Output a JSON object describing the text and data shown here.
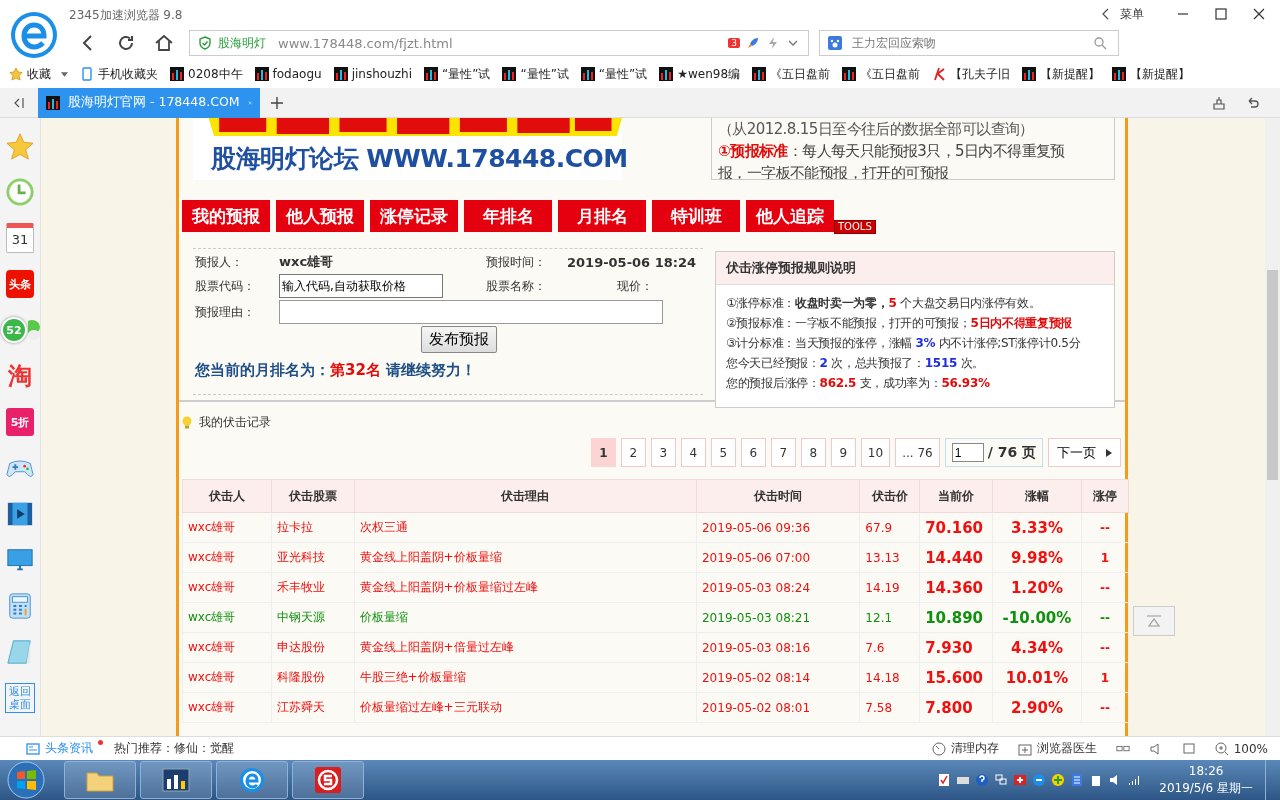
{
  "browser": {
    "title": "2345加速浏览器 9.8",
    "menu": "菜单",
    "site_badge": "股海明灯",
    "url_host": "www.178448.com",
    "url_path": "/fjzt.html",
    "badge_count": "3",
    "search_placeholder": "王力宏回应索吻"
  },
  "bookmarks": [
    {
      "label": "收藏",
      "kind": "folder"
    },
    {
      "label": "手机收藏夹",
      "kind": "mobile"
    },
    {
      "label": "0208中午",
      "kind": "site"
    },
    {
      "label": "fodaogu",
      "kind": "site"
    },
    {
      "label": "jinshouzhi",
      "kind": "site"
    },
    {
      "label": "“量性”试",
      "kind": "site"
    },
    {
      "label": "“量性”试",
      "kind": "site"
    },
    {
      "label": "“量性”试",
      "kind": "site"
    },
    {
      "label": "★wen98编",
      "kind": "site"
    },
    {
      "label": "《五日盘前",
      "kind": "site"
    },
    {
      "label": "《五日盘前",
      "kind": "site"
    },
    {
      "label": "【孔夫子旧",
      "kind": "k"
    },
    {
      "label": "【新提醒】",
      "kind": "site"
    },
    {
      "label": "【新提醒】",
      "kind": "site"
    }
  ],
  "tabs": [
    {
      "label": "股海明灯官网 - 178448.COM",
      "selected": true
    }
  ],
  "sidebar": [
    {
      "kind": "star"
    },
    {
      "kind": "clock"
    },
    {
      "kind": "calendar",
      "text": "31"
    },
    {
      "kind": "red",
      "text": "头条"
    },
    {
      "kind": "chat",
      "badge": "52"
    },
    {
      "kind": "tao",
      "text": "淘"
    },
    {
      "kind": "sale",
      "text": "5折"
    },
    {
      "kind": "gamepad"
    },
    {
      "kind": "video"
    },
    {
      "kind": "monitor"
    },
    {
      "kind": "calculator"
    },
    {
      "kind": "notepad"
    },
    {
      "kind": "desk",
      "text": "返回桌面"
    }
  ],
  "page": {
    "banner_text": "股海明灯论坛 WWW.178448.COM",
    "notice": [
      "（从2012.8.15日至今往后的数据全部可以查询）",
      "**①预报标准**：每人每天只能预报3只，5日内不得重复预",
      "报，一字板不能预报，打开的可预报"
    ],
    "nav": [
      {
        "label": "我的预报",
        "kind": "main"
      },
      {
        "label": "他人预报",
        "kind": "main"
      },
      {
        "label": "涨停记录",
        "kind": "main"
      },
      {
        "label": "年排名",
        "kind": "main"
      },
      {
        "label": "月排名",
        "kind": "main"
      },
      {
        "label": "特训班",
        "kind": "main"
      },
      {
        "label": "他人追踪",
        "kind": "main"
      },
      {
        "label": "TOOLS",
        "kind": "tools"
      }
    ],
    "form": {
      "reporter_label": "预报人：",
      "reporter": "wxc雄哥",
      "time_label": "预报时间：",
      "time": "2019-05-06 18:24",
      "code_label": "股票代码：",
      "code_value": "输入代码,自动获取价格",
      "name_label": "股票名称：",
      "price_label": "现价：",
      "reason_label": "预报理由：",
      "submit": "发布预报"
    },
    "rank": {
      "prefix": "您当前的月排名为：",
      "rank": "第32名",
      "suffix": " 请继续努力！"
    },
    "rules": {
      "title": "伏击涨停预报规则说明",
      "lines": [
        [
          {
            "text": "①涨停标准：",
            "kind": "text"
          },
          {
            "text": "收盘时卖一为零，",
            "kind": "rule"
          },
          {
            "text": "5",
            "kind": "alert"
          },
          {
            "text": " 个大盘交易日内涨停有效。",
            "kind": "text"
          }
        ],
        [
          {
            "text": "②预报标准：一字板不能预报，打开的可预报；",
            "kind": "text"
          },
          {
            "text": "5日内不得重复预报",
            "kind": "alert"
          }
        ],
        [
          {
            "text": "③计分标准：当天预报的涨停，涨幅 ",
            "kind": "text"
          },
          {
            "text": "3%",
            "kind": "number"
          },
          {
            "text": " 内不计涨停;ST涨停计0.5分",
            "kind": "text"
          }
        ],
        [
          {
            "text": "您今天已经预报：",
            "kind": "text"
          },
          {
            "text": "2",
            "kind": "number"
          },
          {
            "text": " 次，总共预报了：",
            "kind": "text"
          },
          {
            "text": "1515",
            "kind": "number"
          },
          {
            "text": " 次。",
            "kind": "text"
          }
        ],
        [
          {
            "text": "您的预报后涨停：",
            "kind": "text"
          },
          {
            "text": "862.5",
            "kind": "alert"
          },
          {
            "text": " 支，成功率为：",
            "kind": "text"
          },
          {
            "text": "56.93%",
            "kind": "alert"
          }
        ]
      ]
    },
    "records_title": "我的伏击记录",
    "pager": {
      "pages": [
        {
          "label": "1",
          "selected": true
        },
        {
          "label": "2",
          "selected": false
        },
        {
          "label": "3",
          "selected": false
        },
        {
          "label": "4",
          "selected": false
        },
        {
          "label": "5",
          "selected": false
        },
        {
          "label": "6",
          "selected": false
        },
        {
          "label": "7",
          "selected": false
        },
        {
          "label": "8",
          "selected": false
        },
        {
          "label": "9",
          "selected": false
        },
        {
          "label": "10",
          "selected": false
        },
        {
          "label": "... 76",
          "selected": false
        }
      ],
      "input": "1",
      "total": "/ 76 页",
      "next": "下一页"
    },
    "table": {
      "columns": [
        "伏击人",
        "伏击股票",
        "伏击理由",
        "伏击时间",
        "伏击价",
        "当前价",
        "涨幅",
        "涨停"
      ],
      "rows": [
        {
          "color": "#f01010",
          "cells": [
            "wxc雄哥",
            "拉卡拉",
            "次权三通",
            "2019-05-06 09:36",
            "67.9",
            "70.160",
            "3.33%",
            "--"
          ]
        },
        {
          "color": "#f01010",
          "cells": [
            "wxc雄哥",
            "亚光科技",
            "黄金线上阳盖阴+价板量缩",
            "2019-05-06 07:00",
            "13.13",
            "14.440",
            "9.98%",
            "1"
          ]
        },
        {
          "color": "#f01010",
          "cells": [
            "wxc雄哥",
            "禾丰牧业",
            "黄金线上阳盖阴+价板量缩过左峰",
            "2019-05-03 08:24",
            "14.19",
            "14.360",
            "1.20%",
            "--"
          ]
        },
        {
          "color": "#109010",
          "cells": [
            "wxc雄哥",
            "中钢天源",
            "价板量缩",
            "2019-05-03 08:21",
            "12.1",
            "10.890",
            "-10.00%",
            "--"
          ]
        },
        {
          "color": "#f01010",
          "cells": [
            "wxc雄哥",
            "申达股份",
            "黄金线上阳盖阴+倍量过左峰",
            "2019-05-03 08:16",
            "7.6",
            "7.930",
            "4.34%",
            "--"
          ]
        },
        {
          "color": "#f01010",
          "cells": [
            "wxc雄哥",
            "科隆股份",
            "牛股三绝+价板量缩",
            "2019-05-02 08:14",
            "14.18",
            "15.600",
            "10.01%",
            "1"
          ]
        },
        {
          "color": "#f01010",
          "cells": [
            "wxc雄哥",
            "江苏舜天",
            "价板量缩过左峰+三元联动",
            "2019-05-02 08:01",
            "7.58",
            "7.800",
            "2.90%",
            "--"
          ]
        }
      ]
    }
  },
  "status_bar": {
    "news": "头条资讯",
    "hot": "热门推荐：修仙：觉醒",
    "clean": "清理内存",
    "doctor": "浏览器医生",
    "zoom": "100%"
  },
  "taskbar": {
    "apps": [
      {
        "kind": "folder",
        "selected": false
      },
      {
        "kind": "stock",
        "selected": false
      },
      {
        "kind": "browser",
        "selected": false
      },
      {
        "kind": "s",
        "selected": false
      }
    ],
    "time": "18:26",
    "date": "2019/5/6 星期一"
  }
}
